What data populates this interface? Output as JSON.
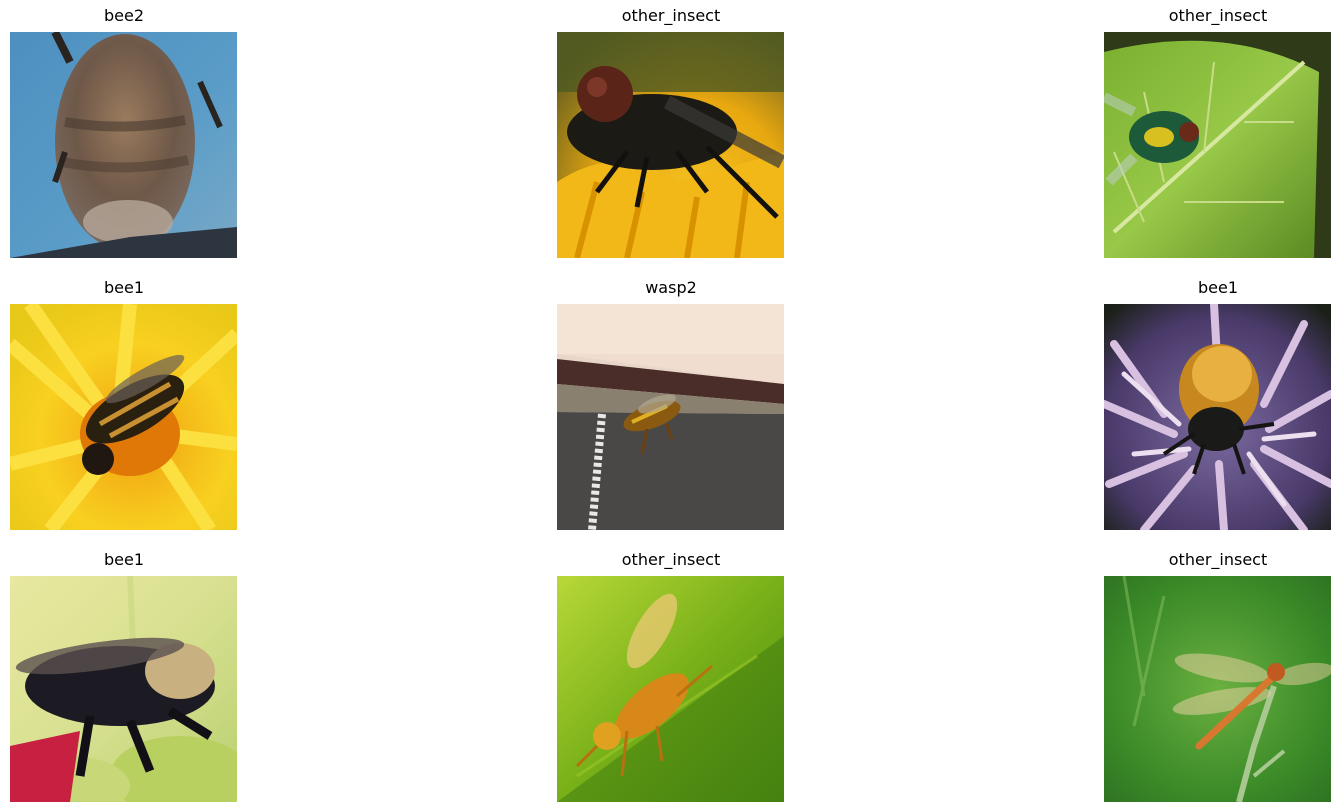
{
  "figure": {
    "panels": [
      {
        "label": "bee2"
      },
      {
        "label": "other_insect"
      },
      {
        "label": "other_insect"
      },
      {
        "label": "bee1"
      },
      {
        "label": "wasp2"
      },
      {
        "label": "bee1"
      },
      {
        "label": "bee1"
      },
      {
        "label": "other_insect"
      },
      {
        "label": "other_insect"
      }
    ]
  },
  "images": {
    "p0": "blurred close-up of bee abdomen on blue background",
    "p1": "fly with red eyes on yellow flower",
    "p2": "green metallic fly on green leaf",
    "p3": "bee on yellow dandelion",
    "p4": "wasp on edge of dark fabric",
    "p5": "bumblebee on purple thistle flower",
    "p6": "black bumblebee on green leaves",
    "p7": "orange fly on bright green leaf",
    "p8": "dragonfly on plant stem with green background"
  }
}
